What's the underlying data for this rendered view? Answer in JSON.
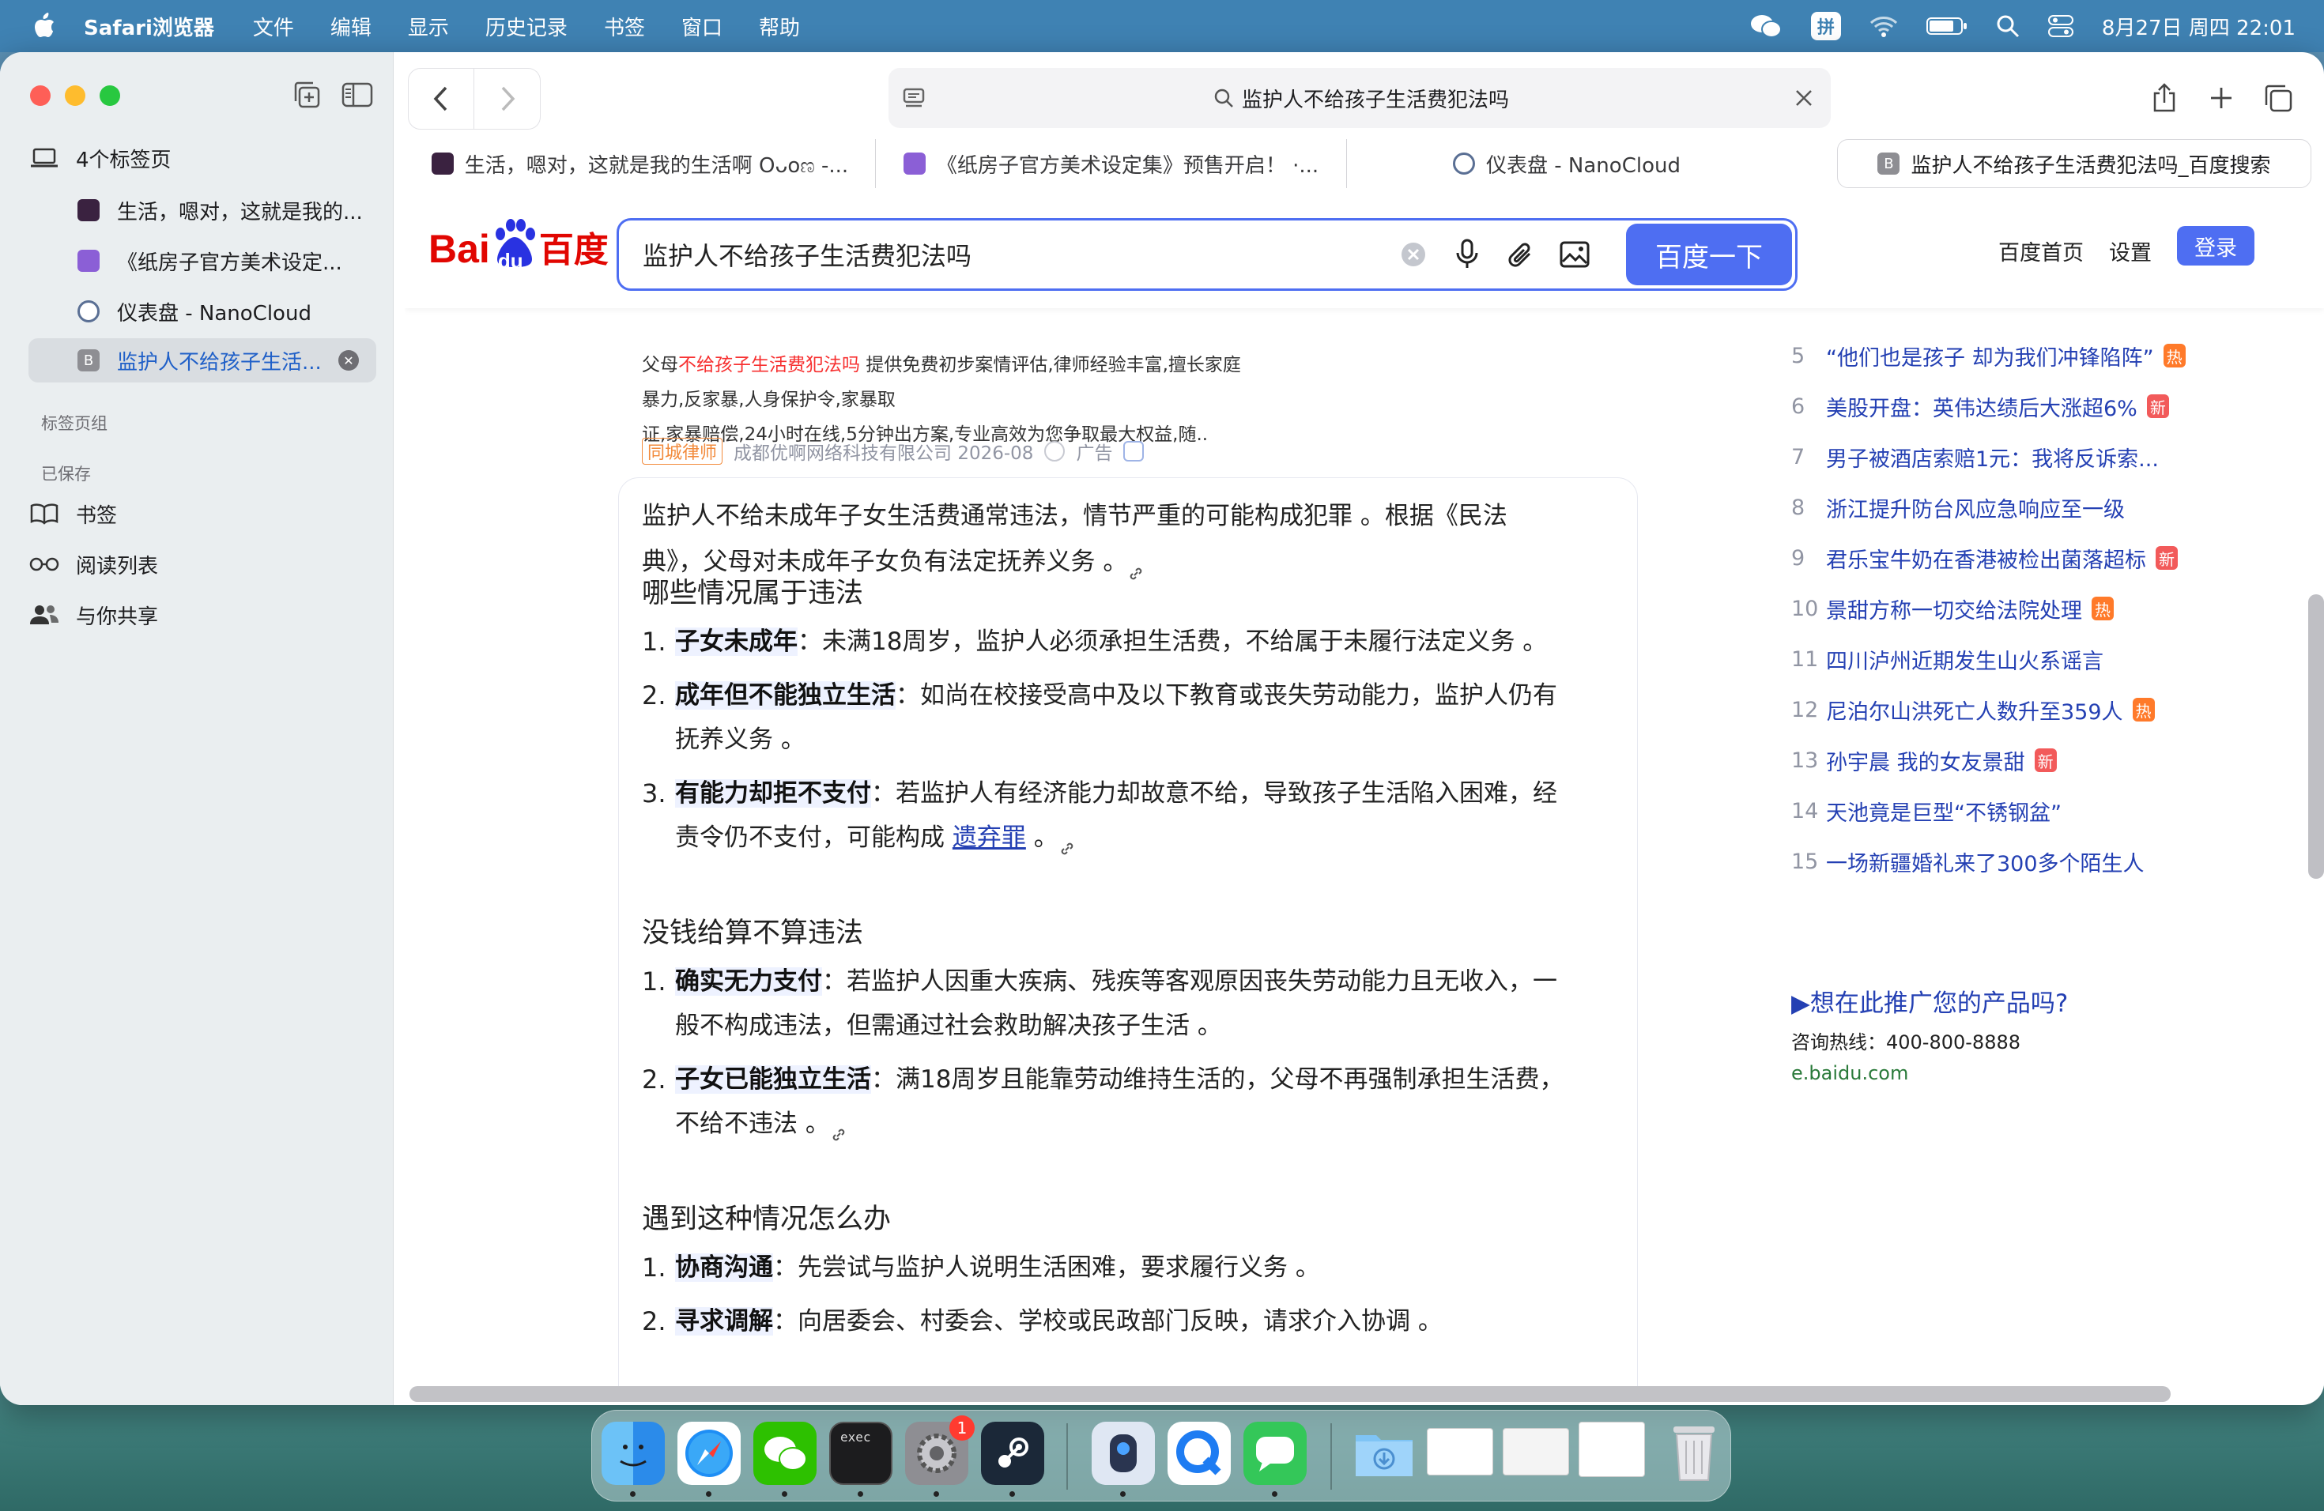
{
  "menubar": {
    "app_name": "Safari浏览器",
    "items": [
      "文件",
      "编辑",
      "显示",
      "历史记录",
      "书签",
      "窗口",
      "帮助"
    ],
    "input_method": "拼",
    "datetime": "8月27日 周四  22:01"
  },
  "sidebar": {
    "tabs_group_label": "4个标签页",
    "tabs": [
      {
        "label": "生活，嗯对，这就是我的...",
        "color": "#4a2a4a"
      },
      {
        "label": "《纸房子官方美术设定...",
        "color": "#8b5fd6"
      },
      {
        "label": "仪表盘 - NanoCloud",
        "color": "#6b7fa3"
      },
      {
        "label": "监护人不给孩子生活...",
        "color": "#8e8e93"
      }
    ],
    "tab_groups_heading": "标签页组",
    "saved_heading": "已保存",
    "saved": [
      {
        "label": "书签",
        "icon": "book-icon"
      },
      {
        "label": "阅读列表",
        "icon": "glasses-icon"
      },
      {
        "label": "与你共享",
        "icon": "shared-people-icon"
      }
    ]
  },
  "toolbar": {
    "address": "监护人不给孩子生活费犯法吗"
  },
  "tabs": [
    {
      "label": "生活，嗯对，这就是我的生活啊 Oᴗoಣ -..."
    },
    {
      "label": "《纸房子官方美术设定集》预售开启！ ·..."
    },
    {
      "label": "仪表盘 - NanoCloud"
    },
    {
      "label": "监护人不给孩子生活费犯法吗_百度搜索"
    }
  ],
  "baidu": {
    "logo_bai": "Bai",
    "logo_du": "du",
    "logo_cn": "百度",
    "query": "监护人不给孩子生活费犯法吗",
    "search_button": "百度一下",
    "home_link": "百度首页",
    "settings_link": "设置",
    "login_button": "登录",
    "brand_color": "#4e6ef2"
  },
  "ad": {
    "line1_prefix": "父母",
    "line1_highlight": "不给孩子生活费犯法吗",
    "line1_rest": "提供免费初步案情评估,律师经验丰富,擅长家庭暴力,反家暴,人身保护令,家暴取",
    "line2": "证,家暴赔偿,24小时在线,5分钟出方案,专业高效为您争取最大权益,随..",
    "badge": "同城律师",
    "company": "成都优啊网络科技有限公司 2026-08",
    "ad_label": "广告"
  },
  "answer": {
    "intro_line1": "监护人不给未成年子女生活费通常违法，情节严重的可能构成犯罪 。根据《民法",
    "intro_line2": "典》，父母对未成年子女负有法定抚养义务 。",
    "sections": [
      {
        "heading": "哪些情况属于违法",
        "items": [
          {
            "num": "1.",
            "bold": "子女未成年",
            "text": "：未满18周岁，监护人必须承担生活费，不给属于未履行法定义务 。",
            "cont": ""
          },
          {
            "num": "2.",
            "bold": "成年但不能独立生活",
            "text": "：如尚在校接受高中及以下教育或丧失劳动能力，监护人仍有",
            "cont": "抚养义务 。"
          },
          {
            "num": "3.",
            "bold": "有能力却拒不支付",
            "text": "：若监护人有经济能力却故意不给，导致孩子生活陷入困难，经",
            "cont": "责令仍不支付，可能构成 ",
            "link": "遗弃罪",
            "after": " 。"
          }
        ]
      },
      {
        "heading": "没钱给算不算违法",
        "items": [
          {
            "num": "1.",
            "bold": "确实无力支付",
            "text": "：若监护人因重大疾病、残疾等客观原因丧失劳动能力且无收入，一",
            "cont": "般不构成违法，但需通过社会救助解决孩子生活 。"
          },
          {
            "num": "2.",
            "bold": "子女已能独立生活",
            "text": "：满18周岁且能靠劳动维持生活的，父母不再强制承担生活费，",
            "cont": "不给不违法 。"
          }
        ]
      },
      {
        "heading": "遇到这种情况怎么办",
        "items": [
          {
            "num": "1.",
            "bold": "协商沟通",
            "text": "：先尝试与监护人说明生活困难，要求履行义务 。",
            "cont": ""
          },
          {
            "num": "2.",
            "bold": "寻求调解",
            "text": "：向居委会、村委会、学校或民政部门反映，请求介入协调 。",
            "cont": ""
          }
        ]
      }
    ]
  },
  "hotlist": [
    {
      "num": "5",
      "title": "“他们也是孩子 却为我们冲锋陷阵”",
      "tag": "热"
    },
    {
      "num": "6",
      "title": "美股开盘：英伟达绩后大涨超6%",
      "tag": "新"
    },
    {
      "num": "7",
      "title": "男子被酒店索赔1元：我将反诉索...",
      "tag": ""
    },
    {
      "num": "8",
      "title": "浙江提升防台风应急响应至一级",
      "tag": ""
    },
    {
      "num": "9",
      "title": "君乐宝牛奶在香港被检出菌落超标",
      "tag": "新"
    },
    {
      "num": "10",
      "title": "景甜方称一切交给法院处理",
      "tag": "热"
    },
    {
      "num": "11",
      "title": "四川泸州近期发生山火系谣言",
      "tag": ""
    },
    {
      "num": "12",
      "title": "尼泊尔山洪死亡人数升至359人",
      "tag": "热"
    },
    {
      "num": "13",
      "title": "孙宇晨 我的女友景甜",
      "tag": "新"
    },
    {
      "num": "14",
      "title": "天池竟是巨型“不锈钢盆”",
      "tag": ""
    },
    {
      "num": "15",
      "title": "一场新疆婚礼来了300多个陌生人",
      "tag": ""
    }
  ],
  "promo": {
    "title": "▶想在此推广您的产品吗?",
    "hotline": "咨询热线：400-800-8888",
    "url": "e.baidu.com"
  },
  "dock": {
    "exec_label": "exec",
    "settings_badge": "1"
  }
}
